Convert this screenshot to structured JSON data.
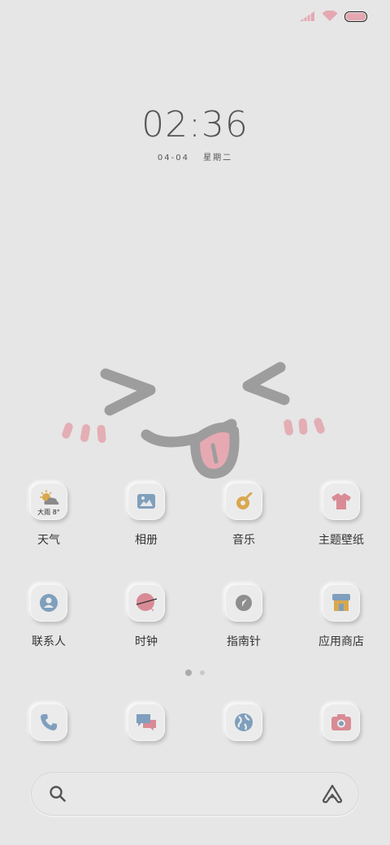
{
  "clock": {
    "time": "02:36",
    "date": "04-04",
    "weekday": "星期二"
  },
  "apps_row1": [
    {
      "label": "天气",
      "icon": "weather-icon",
      "badge": "大雨 8°"
    },
    {
      "label": "相册",
      "icon": "gallery-icon"
    },
    {
      "label": "音乐",
      "icon": "music-icon"
    },
    {
      "label": "主题壁纸",
      "icon": "theme-shirt-icon"
    }
  ],
  "apps_row2": [
    {
      "label": "联系人",
      "icon": "contacts-icon"
    },
    {
      "label": "时钟",
      "icon": "clock-icon"
    },
    {
      "label": "指南针",
      "icon": "compass-icon"
    },
    {
      "label": "应用商店",
      "icon": "store-icon"
    }
  ],
  "dock": [
    {
      "icon": "phone-icon"
    },
    {
      "icon": "messages-icon"
    },
    {
      "icon": "browser-icon"
    },
    {
      "icon": "camera-icon"
    }
  ],
  "page_indicator": {
    "pages": 2,
    "current": 1
  },
  "colors": {
    "background": "#e6e6e6",
    "pink": "#e5a8b3",
    "blue": "#7f9fbd",
    "gold": "#d9a84e"
  }
}
